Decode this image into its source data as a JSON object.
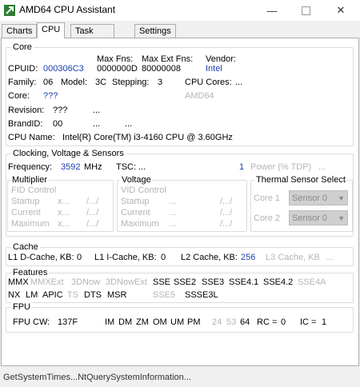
{
  "window": {
    "title": "AMD64 CPU Assistant"
  },
  "tabs": [
    "Charts",
    "CPU",
    "Task Manager",
    "Settings"
  ],
  "core": {
    "title": "Core",
    "hdr_fns": "Max Fns:",
    "hdr_ext": "Max Ext Fns:",
    "hdr_vendor": "Vendor:",
    "cpuid_label": "CPUID:",
    "cpuid_value": "000306C3",
    "max_fns": "0000000D",
    "max_ext": "80000008",
    "vendor": "Intel",
    "family_label": "Family:",
    "family": "06",
    "model_label": "Model:",
    "model": "3C",
    "stepping_label": "Stepping:",
    "stepping": "3",
    "cpu_cores_label": "CPU Cores:",
    "cpu_cores": "...",
    "core_label": "Core:",
    "core_value": "???",
    "core_extra": "AMD64",
    "revision_label": "Revision:",
    "revision": "???",
    "revision_extra": "...",
    "brandid_label": "BrandID:",
    "brandid": "00",
    "brandid_extra1": "...",
    "brandid_extra2": "...",
    "cpuname_label": "CPU Name:",
    "cpuname": "Intel(R) Core(TM) i3-4160 CPU @ 3.60GHz"
  },
  "clocking": {
    "title": "Clocking, Voltage & Sensors",
    "freq_label": "Frequency:",
    "freq_value": "3592",
    "freq_unit": "MHz",
    "tsc_label": "TSC:",
    "tsc_value": "...",
    "power_value": "1",
    "power_label": "Power (% TDP)",
    "power_extra": "...",
    "multiplier": {
      "title": "Multiplier",
      "fid": "FID Control",
      "startup": "Startup",
      "current": "Current",
      "maximum": "Maximum",
      "x": "x...",
      "slash": "/.../"
    },
    "voltage": {
      "title": "Voltage",
      "vid": "VID Control",
      "startup": "Startup",
      "current": "Current",
      "maximum": "Maximum",
      "dots": "...",
      "slash": "/.../"
    },
    "thermal": {
      "title": "Thermal Sensor Select",
      "core1": "Core 1",
      "core2": "Core 2",
      "sensor1": "Sensor 0",
      "sensor2": "Sensor 0"
    }
  },
  "cache": {
    "title": "Cache",
    "l1d_label": "L1 D-Cache, KB:",
    "l1d": "0",
    "l1i_label": "L1 I-Cache, KB:",
    "l1i": "0",
    "l2_label": "L2 Cache, KB:",
    "l2": "256",
    "l3_label": "L3 Cache, KB",
    "l3": "..."
  },
  "features": {
    "title": "Features",
    "row1": [
      {
        "t": "MMX",
        "on": true
      },
      {
        "t": "MMXExt",
        "on": false
      },
      {
        "t": "3DNow",
        "on": false
      },
      {
        "t": "3DNowExt",
        "on": false
      },
      {
        "t": "SSE",
        "on": true
      },
      {
        "t": "SSE2",
        "on": true
      },
      {
        "t": "SSE3",
        "on": true
      },
      {
        "t": "SSE4.1",
        "on": true
      },
      {
        "t": "SSE4.2",
        "on": true
      },
      {
        "t": "SSE4A",
        "on": false
      }
    ],
    "row2": [
      {
        "t": "NX",
        "on": true
      },
      {
        "t": "LM",
        "on": true
      },
      {
        "t": "APIC",
        "on": true
      },
      {
        "t": "TS",
        "on": false
      },
      {
        "t": "DTS",
        "on": true
      },
      {
        "t": "MSR",
        "on": true
      },
      {
        "t": "SSE5",
        "on": false
      },
      {
        "t": "SSSE3L",
        "on": true
      }
    ]
  },
  "fpu": {
    "title": "FPU",
    "cw_label": "FPU CW:",
    "cw": "137F",
    "flags": [
      {
        "t": "IM",
        "on": true
      },
      {
        "t": "DM",
        "on": true
      },
      {
        "t": "ZM",
        "on": true
      },
      {
        "t": "OM",
        "on": true
      },
      {
        "t": "UM",
        "on": true
      },
      {
        "t": "PM",
        "on": true
      },
      {
        "t": "24",
        "on": false
      },
      {
        "t": "53",
        "on": false
      },
      {
        "t": "64",
        "on": true
      }
    ],
    "rc_label": "RC =",
    "rc": "0",
    "ic_label": "IC =",
    "ic": "1"
  },
  "status": {
    "text": "GetSystemTimes...NtQuerySystemInformation..."
  }
}
